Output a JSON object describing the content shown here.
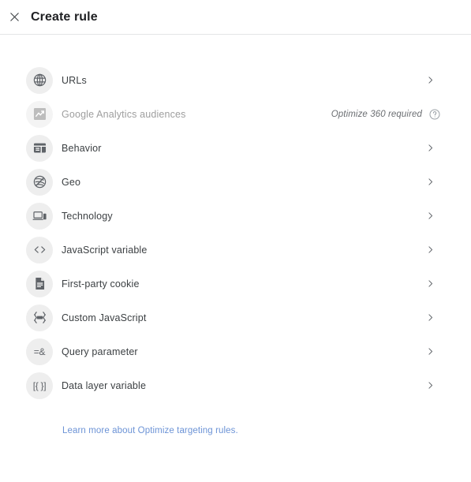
{
  "header": {
    "title": "Create rule",
    "close_icon": "close-icon"
  },
  "rules": [
    {
      "id": "urls",
      "label": "URLs",
      "icon": "globe-grid-icon",
      "glyph": "",
      "disabled": false,
      "chevron": true,
      "meta": "",
      "help": false
    },
    {
      "id": "ga-audiences",
      "label": "Google Analytics audiences",
      "icon": "analytics-trend-icon",
      "glyph": "",
      "disabled": true,
      "chevron": false,
      "meta": "Optimize 360 required",
      "help": true
    },
    {
      "id": "behavior",
      "label": "Behavior",
      "icon": "web-layout-icon",
      "glyph": "",
      "disabled": false,
      "chevron": true,
      "meta": "",
      "help": false
    },
    {
      "id": "geo",
      "label": "Geo",
      "icon": "geo-globe-icon",
      "glyph": "",
      "disabled": false,
      "chevron": true,
      "meta": "",
      "help": false
    },
    {
      "id": "technology",
      "label": "Technology",
      "icon": "devices-icon",
      "glyph": "",
      "disabled": false,
      "chevron": true,
      "meta": "",
      "help": false
    },
    {
      "id": "js-variable",
      "label": "JavaScript variable",
      "icon": "code-brackets-icon",
      "glyph": "",
      "disabled": false,
      "chevron": true,
      "meta": "",
      "help": false
    },
    {
      "id": "first-party-cookie",
      "label": "First-party cookie",
      "icon": "document-icon",
      "glyph": "",
      "disabled": false,
      "chevron": true,
      "meta": "",
      "help": false
    },
    {
      "id": "custom-javascript",
      "label": "Custom JavaScript",
      "icon": "custom-code-icon",
      "glyph": "",
      "disabled": false,
      "chevron": true,
      "meta": "",
      "help": false
    },
    {
      "id": "query-parameter",
      "label": "Query parameter",
      "icon": "query-param-icon",
      "glyph": "=&",
      "disabled": false,
      "chevron": true,
      "meta": "",
      "help": false
    },
    {
      "id": "data-layer-variable",
      "label": "Data layer variable",
      "icon": "data-layer-icon",
      "glyph": "[{ }]",
      "disabled": false,
      "chevron": true,
      "meta": "",
      "help": false
    }
  ],
  "footer": {
    "learn_more_label": "Learn more about Optimize targeting rules."
  },
  "colors": {
    "title": "#202124",
    "label": "#3c4043",
    "disabled": "#9e9e9e",
    "icon_bg": "#eeeeee",
    "icon_fg": "#5f6368",
    "link": "#6c93d6",
    "divider": "#e4e5e7"
  }
}
